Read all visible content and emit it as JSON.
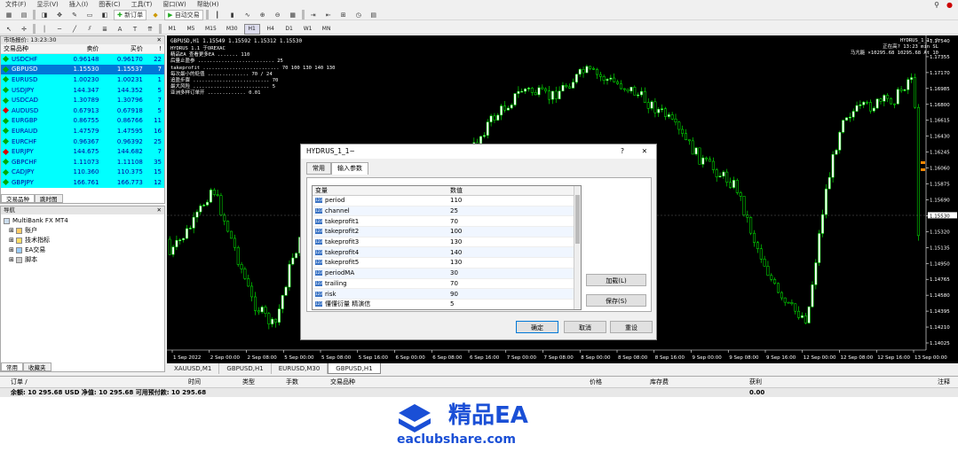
{
  "menu": {
    "items": [
      "文件(F)",
      "显示(V)",
      "插入(I)",
      "图表(C)",
      "工具(T)",
      "窗口(W)",
      "帮助(H)"
    ]
  },
  "toolbar": {
    "new_order": "新订单",
    "auto_trading": "自动交易",
    "timeframes": [
      "M1",
      "M5",
      "M15",
      "M30",
      "H1",
      "H4",
      "D1",
      "W1",
      "MN"
    ],
    "active_tf": "H1"
  },
  "market_watch": {
    "title": "市场报价: 13:23:30",
    "headers": {
      "symbol": "交易品种",
      "bid": "卖价",
      "ask": "买价",
      "spread": "!"
    },
    "rows": [
      {
        "symbol": "USDCHF",
        "bid": "0.96148",
        "ask": "0.96170",
        "spread": "22",
        "dir": "up"
      },
      {
        "symbol": "GBPUSD",
        "bid": "1.15530",
        "ask": "1.15537",
        "spread": "7",
        "dir": "up"
      },
      {
        "symbol": "EURUSD",
        "bid": "1.00230",
        "ask": "1.00231",
        "spread": "1",
        "dir": "up"
      },
      {
        "symbol": "USDJPY",
        "bid": "144.347",
        "ask": "144.352",
        "spread": "5",
        "dir": "up"
      },
      {
        "symbol": "USDCAD",
        "bid": "1.30789",
        "ask": "1.30796",
        "spread": "7",
        "dir": "up"
      },
      {
        "symbol": "AUDUSD",
        "bid": "0.67913",
        "ask": "0.67918",
        "spread": "5",
        "dir": "dn"
      },
      {
        "symbol": "EURGBP",
        "bid": "0.86755",
        "ask": "0.86766",
        "spread": "11",
        "dir": "up"
      },
      {
        "symbol": "EURAUD",
        "bid": "1.47579",
        "ask": "1.47595",
        "spread": "16",
        "dir": "up"
      },
      {
        "symbol": "EURCHF",
        "bid": "0.96367",
        "ask": "0.96392",
        "spread": "25",
        "dir": "up"
      },
      {
        "symbol": "EURJPY",
        "bid": "144.675",
        "ask": "144.682",
        "spread": "7",
        "dir": "dn"
      },
      {
        "symbol": "GBPCHF",
        "bid": "1.11073",
        "ask": "1.11108",
        "spread": "35",
        "dir": "up"
      },
      {
        "symbol": "CADJPY",
        "bid": "110.360",
        "ask": "110.375",
        "spread": "15",
        "dir": "up"
      },
      {
        "symbol": "GBPJPY",
        "bid": "166.761",
        "ask": "166.773",
        "spread": "12",
        "dir": "up"
      }
    ],
    "tabs": [
      "交易品种",
      "跳时图"
    ]
  },
  "navigator": {
    "title": "导航",
    "root": "MultiBank FX MT4",
    "items": [
      "账户",
      "技术指标",
      "EA交易",
      "脚本"
    ],
    "tabs": [
      "常用",
      "收藏夹"
    ]
  },
  "chart": {
    "header": "GBPUSD,H1  1.15549 1.15592 1.15312 1.15530",
    "ea_name": "HYDRUS_1_1~",
    "info_lines": [
      "HYDRUS 1.1 于OREXAC",
      "精品EA 查看更多EA ....... 110",
      "  后量止盈参 .......................... 25",
      "takeprofit .......................... 70 100 130 140 130",
      "每次最小的贬值 .............. 70 / 24",
      "追盈步骤 .......................... 70",
      "最大风险 .......................... 5",
      "亚洲多样订单开  ............. 0.01"
    ],
    "right_info": [
      "HYDRUS_1_1~ ☺",
      "正在高? 13:23 min SL",
      "马亢能 ×10295.68 10295.68 At 10"
    ],
    "price_labels": [
      "1.17540",
      "1.17355",
      "1.17170",
      "1.16985",
      "1.16800",
      "1.16615",
      "1.16430",
      "1.16245",
      "1.16060",
      "1.15875",
      "1.15690",
      "1.15530",
      "1.15320",
      "1.15135",
      "1.14950",
      "1.14765",
      "1.14580",
      "1.14395",
      "1.14210",
      "1.14025"
    ],
    "current_price": "1.15530",
    "time_labels": [
      "1 Sep 2022",
      "2 Sep 00:00",
      "2 Sep 08:00",
      "5 Sep 00:00",
      "5 Sep 08:00",
      "5 Sep 16:00",
      "6 Sep 00:00",
      "6 Sep 08:00",
      "6 Sep 16:00",
      "7 Sep 00:00",
      "7 Sep 08:00",
      "8 Sep 00:00",
      "8 Sep 08:00",
      "8 Sep 16:00",
      "9 Sep 00:00",
      "9 Sep 08:00",
      "9 Sep 16:00",
      "12 Sep 00:00",
      "12 Sep 08:00",
      "12 Sep 16:00",
      "13 Sep 00:00"
    ],
    "tabs": [
      "XAUUSD,M1",
      "GBPUSD,H1",
      "EURUSD,M30",
      "GBPUSD,H1"
    ],
    "active_tab": "GBPUSD,H1"
  },
  "dialog": {
    "title": "HYDRUS_1_1~",
    "help": "?",
    "close": "✕",
    "tabs": [
      "常用",
      "输入参数"
    ],
    "headers": {
      "var": "变量",
      "val": "数值"
    },
    "params": [
      {
        "name": "period",
        "value": "110"
      },
      {
        "name": "channel",
        "value": "25"
      },
      {
        "name": "takeprofit1",
        "value": "70"
      },
      {
        "name": "takeprofit2",
        "value": "100"
      },
      {
        "name": "takeprofit3",
        "value": "130"
      },
      {
        "name": "takeprofit4",
        "value": "140"
      },
      {
        "name": "takeprofit5",
        "value": "130"
      },
      {
        "name": "periodMA",
        "value": "30"
      },
      {
        "name": "trailing",
        "value": "70"
      },
      {
        "name": "risk",
        "value": "90"
      },
      {
        "name": "懂懂衍量 精演信",
        "value": "5"
      }
    ],
    "load": "加载(L)",
    "save": "保存(S)",
    "ok": "确定",
    "cancel": "取消",
    "reset": "重设"
  },
  "terminal": {
    "headers": [
      "订单  /",
      "时间",
      "类型",
      "手数",
      "交易品种",
      "价格",
      "库存费",
      "获利",
      "注释"
    ],
    "balance": "余额: 10 295.68 USD  净值: 10 295.68  可用预付款: 10 295.68",
    "profit": "0.00"
  },
  "watermark": {
    "brand": "精品EA",
    "site": "eaclubshare.com",
    "color": "#1a4fd6"
  }
}
